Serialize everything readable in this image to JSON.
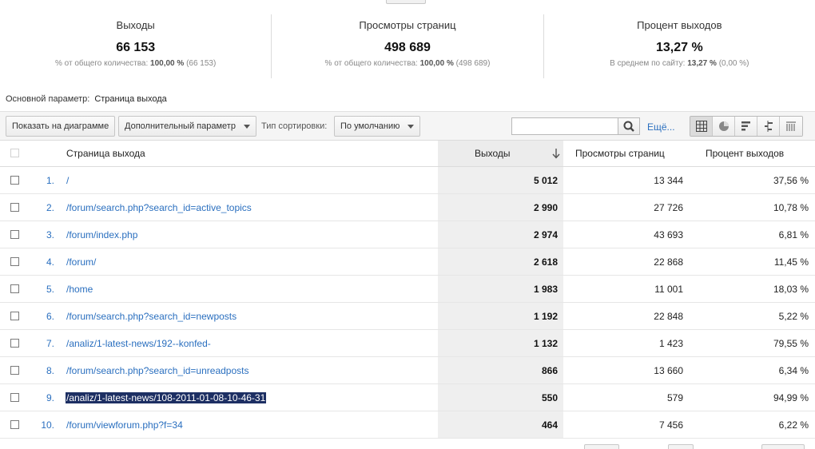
{
  "summary": [
    {
      "label": "Выходы",
      "value": "66 153",
      "sub_prefix": "% от общего количества:",
      "sub_bold": "100,00 %",
      "sub_suffix": "(66 153)"
    },
    {
      "label": "Просмотры страниц",
      "value": "498 689",
      "sub_prefix": "% от общего количества:",
      "sub_bold": "100,00 %",
      "sub_suffix": "(498 689)"
    },
    {
      "label": "Процент выходов",
      "value": "13,27 %",
      "sub_prefix": "В среднем по сайту:",
      "sub_bold": "13,27 %",
      "sub_suffix": "(0,00 %)"
    }
  ],
  "dimension": {
    "label": "Основной параметр:",
    "value": "Страница выхода"
  },
  "toolbar": {
    "plot_button": "Показать на диаграмме",
    "secondary_dimension": "Дополнительный параметр",
    "sort_label": "Тип сортировки:",
    "sort_value": "По умолчанию",
    "search_placeholder": "",
    "more_link": "Ещё..."
  },
  "table": {
    "headers": {
      "page": "Страница выхода",
      "exits": "Выходы",
      "views": "Просмотры страниц",
      "rate": "Процент выходов"
    },
    "rows": [
      {
        "num": "1.",
        "page": "/",
        "exits": "5 012",
        "views": "13 344",
        "rate": "37,56 %"
      },
      {
        "num": "2.",
        "page": "/forum/search.php?search_id=active_topics",
        "exits": "2 990",
        "views": "27 726",
        "rate": "10,78 %"
      },
      {
        "num": "3.",
        "page": "/forum/index.php",
        "exits": "2 974",
        "views": "43 693",
        "rate": "6,81 %"
      },
      {
        "num": "4.",
        "page": "/forum/",
        "exits": "2 618",
        "views": "22 868",
        "rate": "11,45 %"
      },
      {
        "num": "5.",
        "page": "/home",
        "exits": "1 983",
        "views": "11 001",
        "rate": "18,03 %"
      },
      {
        "num": "6.",
        "page": "/forum/search.php?search_id=newposts",
        "exits": "1 192",
        "views": "22 848",
        "rate": "5,22 %"
      },
      {
        "num": "7.",
        "page": "/analiz/1-latest-news/192--konfed-",
        "exits": "1 132",
        "views": "1 423",
        "rate": "79,55 %"
      },
      {
        "num": "8.",
        "page": "/forum/search.php?search_id=unreadposts",
        "exits": "866",
        "views": "13 660",
        "rate": "6,34 %"
      },
      {
        "num": "9.",
        "page": "/analiz/1-latest-news/108-2011-01-08-10-46-31",
        "exits": "550",
        "views": "579",
        "rate": "94,99 %"
      },
      {
        "num": "10.",
        "page": "/forum/viewforum.php?f=34",
        "exits": "464",
        "views": "7 456",
        "rate": "6,22 %"
      }
    ]
  },
  "colors": {
    "link": "#2a6fbf",
    "selection": "#1d2f63",
    "sorted_column": "#efefef"
  }
}
